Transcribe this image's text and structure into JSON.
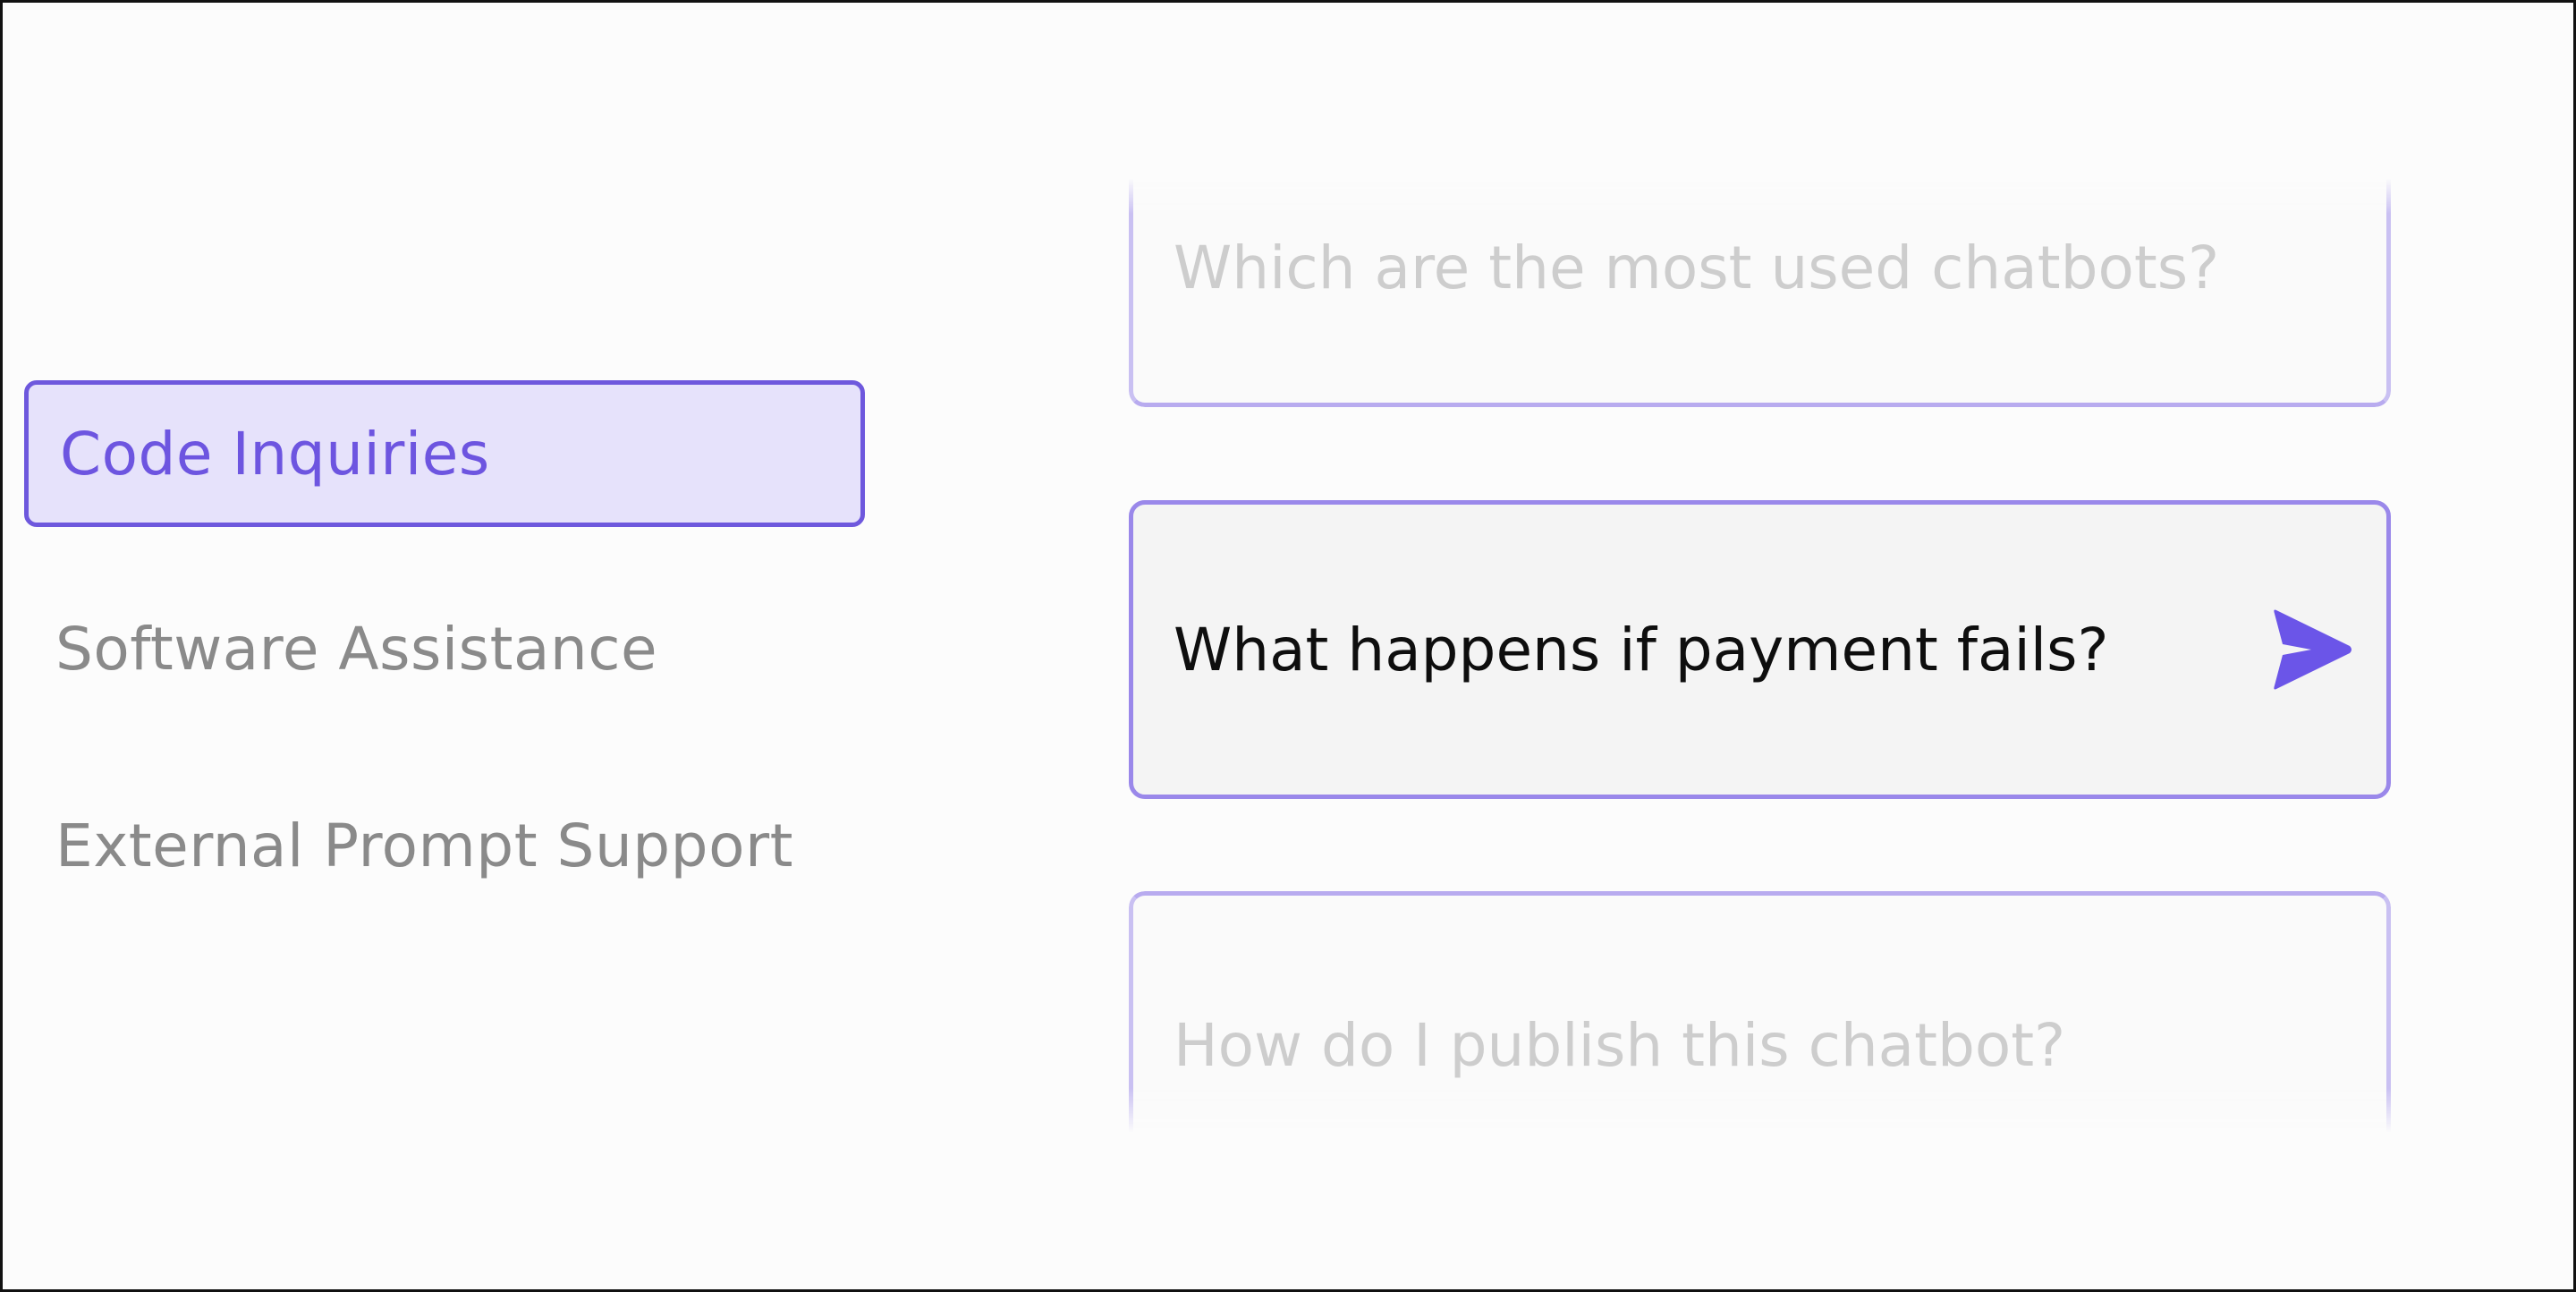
{
  "categories": {
    "items": [
      {
        "label": "Code Inquiries",
        "active": true
      },
      {
        "label": "Software Assistance",
        "active": false
      },
      {
        "label": "External Prompt Support",
        "active": false
      }
    ]
  },
  "prompts": {
    "items": [
      {
        "text": "Which are the most used chatbots?"
      },
      {
        "text": "What happens if payment fails?"
      },
      {
        "text": "How do I publish this chatbot?"
      }
    ],
    "send_icon": "send-arrow-icon"
  },
  "colors": {
    "accent": "#6e58dd",
    "active_bg": "#e6e2fb",
    "send_icon": "#6b55e8",
    "muted_text": "#8a8a8a",
    "faded_text": "#cdcdcd"
  }
}
